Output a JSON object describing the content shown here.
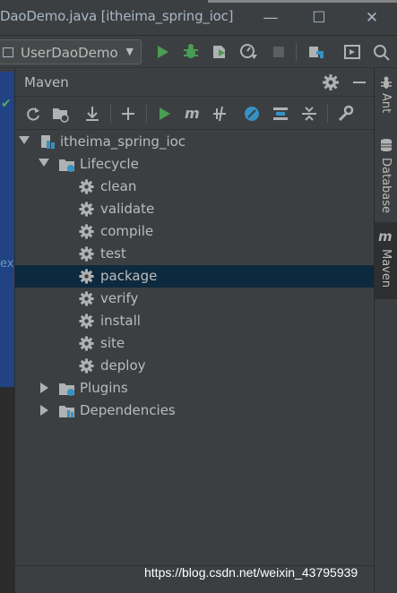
{
  "window": {
    "title": "DaoDemo.java [itheima_spring_ioc]",
    "minimize_glyph": "—",
    "maximize_glyph": "☐",
    "close_glyph": "✕"
  },
  "toolbar": {
    "run_config": "UserDaoDemo",
    "icons": [
      "config-icon",
      "run-icon",
      "debug-icon",
      "coverage-icon",
      "profile-icon",
      "stop-icon",
      "project-structure-icon",
      "toggle-panel-icon",
      "search-icon"
    ]
  },
  "maven_panel": {
    "title": "Maven",
    "header_icons": [
      "settings-icon",
      "hide-icon"
    ],
    "toolbar_icons": [
      "reload-icon",
      "generate-sources-icon",
      "download-icon",
      "add-icon",
      "run-icon",
      "execute-goal-icon",
      "toggle-offline-icon",
      "skip-tests-icon",
      "show-dependencies-icon",
      "collapse-all-icon",
      "maven-settings-icon"
    ],
    "tree": {
      "project": "itheima_spring_ioc",
      "lifecycle": {
        "label": "Lifecycle",
        "goals": [
          "clean",
          "validate",
          "compile",
          "test",
          "package",
          "verify",
          "install",
          "site",
          "deploy"
        ],
        "selected": "package"
      },
      "plugins": "Plugins",
      "dependencies": "Dependencies"
    }
  },
  "editor": {
    "check_glyph": "✔",
    "fragment": "ex"
  },
  "right_tool_strip": {
    "tabs": [
      {
        "label": "Ant",
        "icon": "ant-icon"
      },
      {
        "label": "Database",
        "icon": "database-icon"
      },
      {
        "label": "Maven",
        "icon": "maven-icon",
        "active": true
      }
    ]
  },
  "watermark": "https://blog.csdn.net/weixin_43795939",
  "colors": {
    "background": "#3c3f41",
    "selection": "#0d293e",
    "run_green": "#499c54",
    "text": "#bbbbbb",
    "editor_blue": "#214283"
  }
}
